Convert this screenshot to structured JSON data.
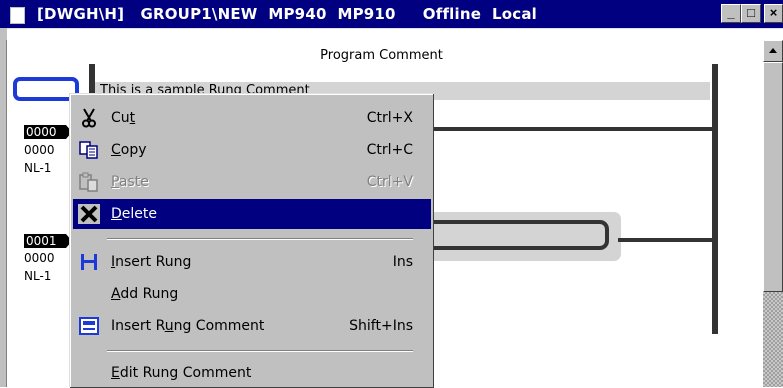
{
  "window": {
    "title": "[DWGH\\H]   GROUP1\\NEW  MP940  MP910     Offline  Local",
    "min_glyph": "_",
    "max_glyph": "□",
    "close_glyph": "×"
  },
  "editor": {
    "program_comment": "Program Comment",
    "rung_comment": "This is a sample Rung Comment",
    "rungs": [
      {
        "number": "0000",
        "step": "0000",
        "nest": "NL-1"
      },
      {
        "number": "0001",
        "step": "0000",
        "nest": "NL-1"
      }
    ]
  },
  "context_menu": {
    "items": [
      {
        "pre": "Cu",
        "key": "t",
        "post": "",
        "shortcut": "Ctrl+X",
        "icon": "scissors-icon",
        "enabled": true,
        "selected": false
      },
      {
        "pre": "",
        "key": "C",
        "post": "opy",
        "shortcut": "Ctrl+C",
        "icon": "copy-icon",
        "enabled": true,
        "selected": false
      },
      {
        "pre": "",
        "key": "P",
        "post": "aste",
        "shortcut": "Ctrl+V",
        "icon": "paste-icon",
        "enabled": false,
        "selected": false
      },
      {
        "pre": "",
        "key": "D",
        "post": "elete",
        "shortcut": "",
        "icon": "delete-x-icon",
        "enabled": true,
        "selected": true
      },
      {
        "pre": "",
        "key": "I",
        "post": "nsert Rung",
        "shortcut": "Ins",
        "icon": "insert-rung-icon",
        "enabled": true,
        "selected": false
      },
      {
        "pre": "",
        "key": "A",
        "post": "dd Rung",
        "shortcut": "",
        "icon": "",
        "enabled": true,
        "selected": false
      },
      {
        "pre": "Insert R",
        "key": "u",
        "post": "ng Comment",
        "shortcut": "Shift+Ins",
        "icon": "insert-comment-icon",
        "enabled": true,
        "selected": false
      },
      {
        "pre": "",
        "key": "E",
        "post": "dit Rung Comment",
        "shortcut": "",
        "icon": "",
        "enabled": true,
        "selected": false
      }
    ]
  },
  "colors": {
    "titlebar": "#000080",
    "menu_selection": "#000080",
    "cursor": "#1c3ad8"
  }
}
